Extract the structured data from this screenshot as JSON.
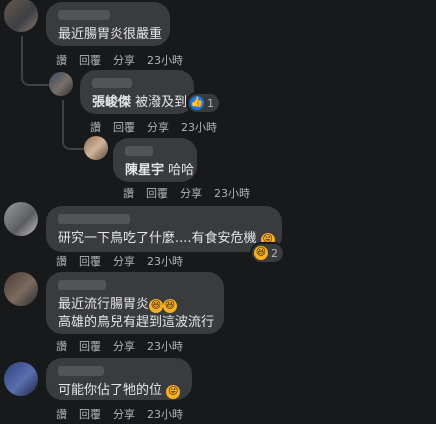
{
  "comments": [
    {
      "text": "最近腸胃炎很嚴重",
      "actions": [
        "讚",
        "回覆",
        "分享"
      ],
      "time": "23小時"
    },
    {
      "name": "張峻傑",
      "text": "被潑及到",
      "reaction_count": "1",
      "actions": [
        "讚",
        "回覆",
        "分享"
      ],
      "time": "23小時"
    },
    {
      "name": "陳星宇",
      "text": "哈哈",
      "actions": [
        "讚",
        "回覆",
        "分享"
      ],
      "time": "23小時"
    },
    {
      "text": "研究一下鳥吃了什麼....有食安危機",
      "reaction_count": "2",
      "actions": [
        "讚",
        "回覆",
        "分享"
      ],
      "time": "23小時"
    },
    {
      "line1": "最近流行腸胃炎",
      "line2": "高雄的鳥兒有趕到這波流行",
      "actions": [
        "讚",
        "回覆",
        "分享"
      ],
      "time": "23小時"
    },
    {
      "text": "可能你佔了牠的位",
      "actions": [
        "讚",
        "回覆",
        "分享"
      ],
      "time": "23小時"
    }
  ],
  "colors": {
    "background": "#18191a",
    "bubble": "#3a3b3c",
    "text": "#e4e6eb",
    "secondary": "#b0b3b8",
    "like_blue": "#1877f2",
    "haha_yellow": "#f7b125"
  },
  "icons": {
    "like": "thumbs-up-icon",
    "haha": "laughing-face-icon",
    "wink": "winking-face-icon"
  }
}
